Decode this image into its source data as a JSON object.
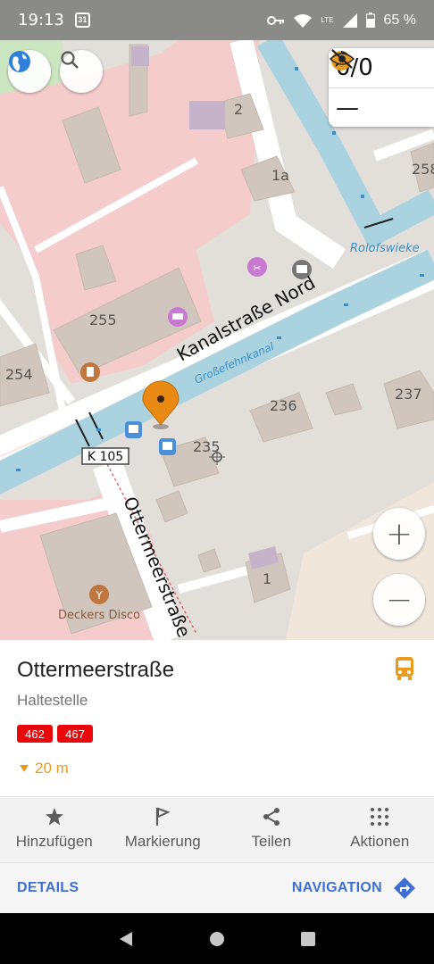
{
  "status_bar": {
    "time": "19:13",
    "calendar_day": "31",
    "network": "LTE",
    "battery": "65 %"
  },
  "map": {
    "labels": {
      "street_kanal": "Kanalstraße Nord",
      "street_otter": "Ottermeerstraße",
      "canal": "Großefehnkanal",
      "rolfswieke": "Rolofswieke",
      "road_ref": "K 105",
      "venue": "Deckers Disco",
      "house_2_top": "2",
      "house_2": "2",
      "house_1a": "1a",
      "house_258": "258",
      "house_255": "255",
      "house_254": "254",
      "house_236": "236",
      "house_237": "237",
      "house_235": "235",
      "house_1": "1"
    },
    "widget": {
      "gps_value": "0/0",
      "hidden_value": "—"
    },
    "zoom_in": "+",
    "zoom_out": "−"
  },
  "poi_panel": {
    "title": "Ottermeerstraße",
    "subtitle": "Haltestelle",
    "routes": [
      "462",
      "467"
    ],
    "distance": "20 m"
  },
  "actions": [
    {
      "label": "Hinzufügen",
      "icon": "star-icon"
    },
    {
      "label": "Markierung",
      "icon": "flag-icon"
    },
    {
      "label": "Teilen",
      "icon": "share-icon"
    },
    {
      "label": "Aktionen",
      "icon": "grid-dots-icon"
    }
  ],
  "bottom_bar": {
    "details": "DETAILS",
    "navigation": "NAVIGATION"
  },
  "colors": {
    "accent_orange": "#e99b1d",
    "route_red": "#e8070a",
    "link_blue": "#3f6fd2",
    "water": "#aad3df"
  }
}
